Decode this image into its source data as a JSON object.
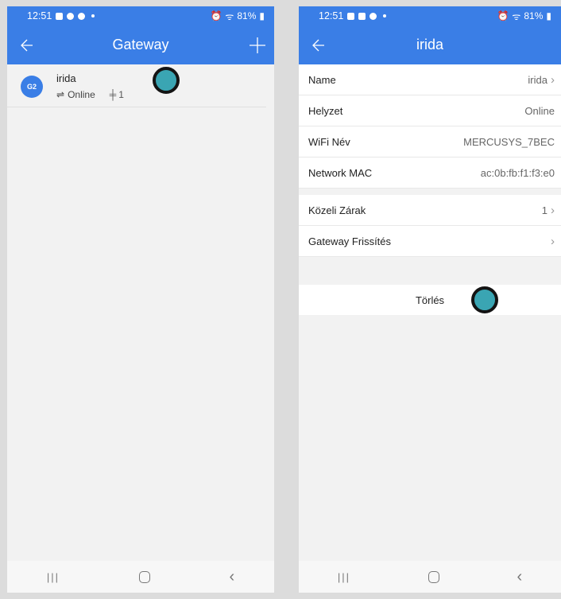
{
  "status": {
    "time": "12:51",
    "battery": "81%"
  },
  "left": {
    "title": "Gateway",
    "gateway": {
      "name": "irida",
      "avatar_label": "G2",
      "status": "Online",
      "lock_count": "1"
    }
  },
  "right": {
    "title": "irida",
    "rows": [
      {
        "label": "Name",
        "value": "irida"
      },
      {
        "label": "Helyzet",
        "value": "Online"
      },
      {
        "label": "WiFi Név",
        "value": "MERCUSYS_7BEC"
      },
      {
        "label": "Network MAC",
        "value": "ac:0b:fb:f1:f3:e0"
      }
    ],
    "rows2": [
      {
        "label": "Közeli Zárak",
        "value": "1"
      },
      {
        "label": "Gateway Frissítés",
        "value": ""
      }
    ],
    "delete_label": "Törlés"
  },
  "colors": {
    "header": "#3a7ee6",
    "marker": "#3aa5b3"
  }
}
